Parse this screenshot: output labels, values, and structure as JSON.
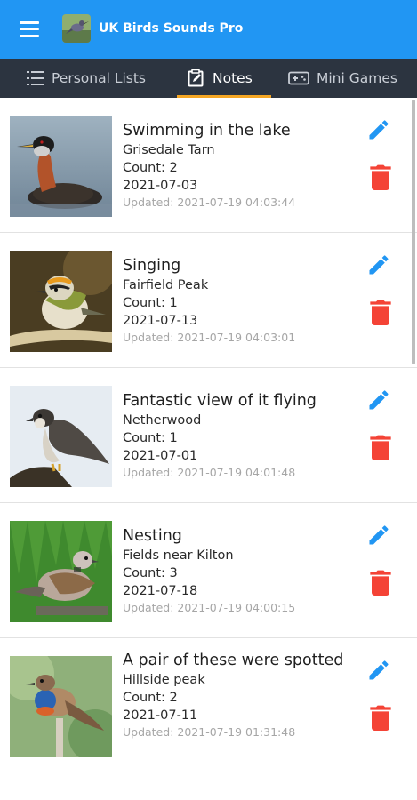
{
  "app": {
    "title": "UK Birds Sounds Pro",
    "accent_color": "#2196F3",
    "tabbar_color": "#2c3440",
    "tab_indicator_color": "#F5A623",
    "menu_icon": "hamburger-menu-icon",
    "logo": "app-logo"
  },
  "tabs": [
    {
      "label": "Personal Lists",
      "icon": "list-icon",
      "active": false
    },
    {
      "label": "Notes",
      "icon": "notes-icon",
      "active": true
    },
    {
      "label": "Mini Games",
      "icon": "gamepad-icon",
      "active": false
    }
  ],
  "notes": [
    {
      "title": "Swimming in the lake",
      "location": "Grisedale Tarn",
      "count": "Count: 2",
      "date": "2021-07-03",
      "updated": "Updated: 2021-07-19 04:03:44",
      "image": "red-necked-grebe"
    },
    {
      "title": "Singing",
      "location": "Fairfield Peak",
      "count": "Count: 1",
      "date": "2021-07-13",
      "updated": "Updated: 2021-07-19 04:03:01",
      "image": "firecrest"
    },
    {
      "title": "Fantastic view of it flying",
      "location": "Netherwood",
      "count": "Count: 1",
      "date": "2021-07-01",
      "updated": "Updated: 2021-07-19 04:01:48",
      "image": "peregrine-falcon"
    },
    {
      "title": "Nesting",
      "location": "Fields near Kilton",
      "count": "Count: 3",
      "date": "2021-07-18",
      "updated": "Updated: 2021-07-19 04:00:15",
      "image": "turtle-dove"
    },
    {
      "title": "A pair of these were spotted",
      "location": "Hillside peak",
      "count": "Count: 2",
      "date": "2021-07-11",
      "updated": "Updated: 2021-07-19 01:31:48",
      "image": "bluethroat"
    }
  ],
  "actions": {
    "edit_icon": "pencil-icon",
    "edit_color": "#2196F3",
    "delete_icon": "trash-icon",
    "delete_color": "#F44336"
  }
}
